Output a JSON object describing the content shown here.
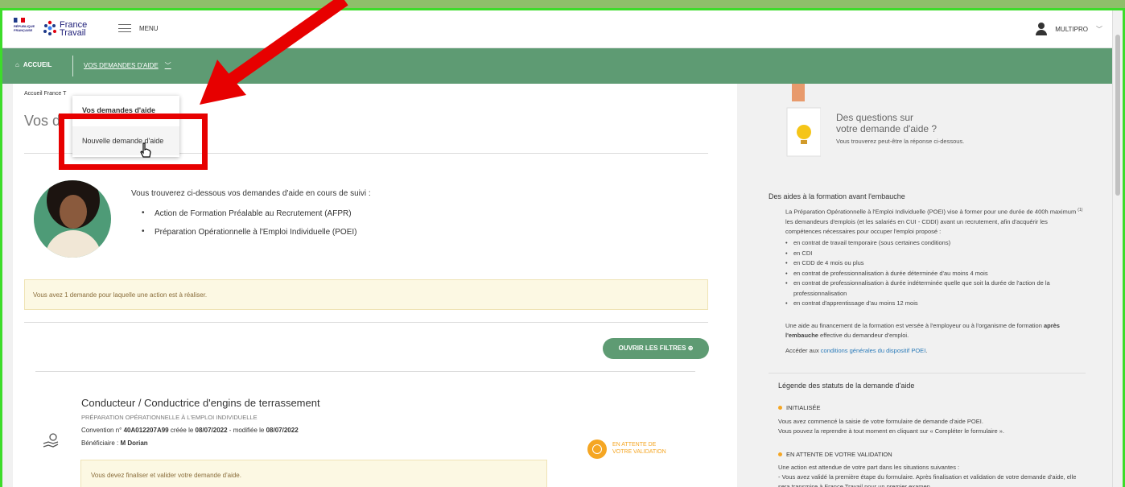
{
  "header": {
    "rf_logo_text": "RÉPUBLIQUE FRANÇAISE",
    "ft_logo_line1": "France",
    "ft_logo_line2": "Travail",
    "menu_label": "MENU",
    "user_label": "MULTIPRO"
  },
  "nav": {
    "home_label": "ACCUEIL",
    "demandes_label": "VOS DEMANDES D'AIDE"
  },
  "dropdown": {
    "item1": "Vos demandes d'aide",
    "item2": "Nouvelle demande d'aide"
  },
  "main": {
    "breadcrumb": "Accueil France T",
    "title": "Vos d",
    "intro": "Vous trouverez ci-dessous vos demandes d'aide en cours de suivi :",
    "intro_items": [
      "Action de Formation Préalable au Recrutement (AFPR)",
      "Préparation Opérationnelle à l'Emploi Individuelle (POEI)"
    ],
    "alert": "Vous avez 1 demande pour laquelle une action est à réaliser.",
    "filter_button": "OUVRIR LES FILTRES",
    "card": {
      "title": "Conducteur / Conductrice d'engins de terrassement",
      "type": "PRÉPARATION OPÉRATIONNELLE À L'EMPLOI INDIVIDUELLE",
      "conv_prefix": "Convention n° ",
      "conv_number": "40A012207A99",
      "conv_created": " créée le ",
      "created_date": "08/07/2022",
      "conv_modified": " - modifiée le ",
      "modified_date": "08/07/2022",
      "benef_prefix": "Bénéficiaire : ",
      "benef_name": "M Dorian",
      "status": "EN ATTENTE DE VOTRE VALIDATION",
      "finalise": "Vous devez finaliser et valider votre demande d'aide."
    }
  },
  "side": {
    "q_line1": "Des questions sur",
    "q_line2": "votre demande d'aide ?",
    "q_sub": "Vous trouverez peut-être la réponse ci-dessous.",
    "h1": "Des aides à la formation avant l'embauche",
    "p1_a": "La Préparation Opérationnelle à l'Emploi Individuelle (POEI) vise à former pour une durée de 400h maximum ",
    "p1_sup": "(1)",
    "p1_b": " les demandeurs d'emplois (et les salariés en CUI - CDDI) avant un recrutement, afin d'acquérir les compétences nécessaires pour occuper l'emploi proposé :",
    "list": [
      "en contrat de travail temporaire (sous certaines conditions)",
      "en CDI",
      "en CDD de 4 mois ou plus",
      "en contrat de professionnalisation à durée déterminée d'au moins 4 mois",
      "en contrat de professionnalisation à durée indéterminée quelle que soit la durée de l'action de la professionnalisation",
      "en contrat d'apprentissage d'au moins 12 mois"
    ],
    "p2_a": "Une aide au financement de la formation est versée à l'employeur ou à l'organisme de formation ",
    "p2_b": "après l'embauche",
    "p2_c": " effective du demandeur d'emploi.",
    "p3_a": "Accéder aux ",
    "p3_link": "conditions générales du dispositif POEI",
    "p3_b": ".",
    "h2": "Légende des statuts de la demande d'aide",
    "status1": "INITIALISÉE",
    "status1_p1": "Vous avez commencé la saisie de votre formulaire de demande d'aide POEI.",
    "status1_p2": "Vous pouvez la reprendre à tout moment en cliquant sur « Compléter le formulaire ».",
    "status2": "EN ATTENTE DE VOTRE VALIDATION",
    "status2_p1": "Une action est attendue de votre part dans les situations suivantes :",
    "status2_p2": "- Vous avez validé la première étape du formulaire. Après finalisation et validation de votre demande d'aide, elle sera transmise à France Travail pour un premier examen."
  },
  "colors": {
    "nav_green": "#5e9b73",
    "annotation_red": "#e70000",
    "status_orange": "#f5a623",
    "frame_green": "#3ddc2a"
  }
}
